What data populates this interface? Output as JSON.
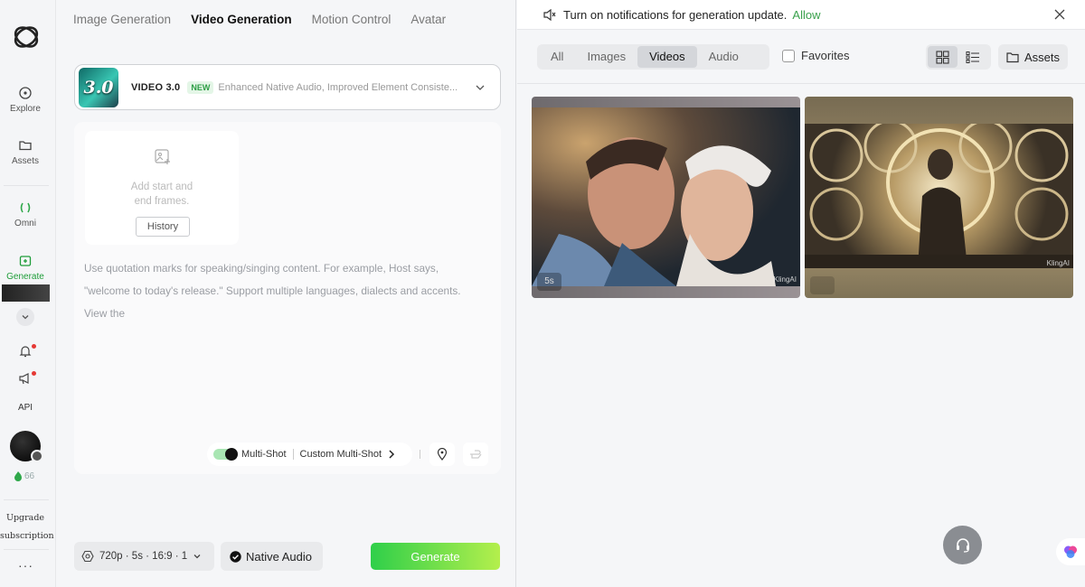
{
  "rail": {
    "items": [
      {
        "label": "Explore"
      },
      {
        "label": "Assets"
      },
      {
        "label": "Omni"
      },
      {
        "label": "Generate"
      }
    ],
    "api_label": "API",
    "credits": "66",
    "upgrade_line1": "Upgrade",
    "upgrade_line2": "subscription",
    "more": "···"
  },
  "left": {
    "tabs": [
      {
        "label": "Image Generation"
      },
      {
        "label": "Video Generation"
      },
      {
        "label": "Motion Control"
      },
      {
        "label": "Avatar"
      }
    ],
    "active_tab": "Video Generation",
    "model": {
      "thumb_text": "3.0",
      "name": "VIDEO 3.0",
      "badge": "NEW",
      "description": "Enhanced Native Audio, Improved Element Consiste..."
    },
    "frames": {
      "text_line1": "Add start and",
      "text_line2": "end frames.",
      "history_label": "History"
    },
    "prompt_placeholder_line1": "Use quotation marks for speaking/singing content. For example, Host says,",
    "prompt_placeholder_line2": "\"welcome to today's release.\" Support multiple languages, dialects and accents.",
    "prompt_placeholder_line3": "View the",
    "multishot_label": "Multi-Shot",
    "custom_multishot_label": "Custom Multi-Shot",
    "settings_label": "720p · 5s · 16:9 · 1",
    "native_audio_label": "Native Audio",
    "generate_label": "Generate"
  },
  "right": {
    "notification_text": "Turn on notifications for generation update.",
    "notification_allow": "Allow",
    "filters": [
      {
        "label": "All"
      },
      {
        "label": "Images"
      },
      {
        "label": "Videos"
      },
      {
        "label": "Audio"
      }
    ],
    "active_filter": "Videos",
    "favorites_label": "Favorites",
    "assets_label": "Assets",
    "videos": [
      {
        "duration": "5s",
        "watermark": "KlingAI"
      },
      {
        "duration": "",
        "watermark": "KlingAI"
      }
    ]
  },
  "colors": {
    "accent_green": "#3aa14c",
    "generate_start": "#2fcf4a",
    "generate_end": "#b4ef4c"
  }
}
